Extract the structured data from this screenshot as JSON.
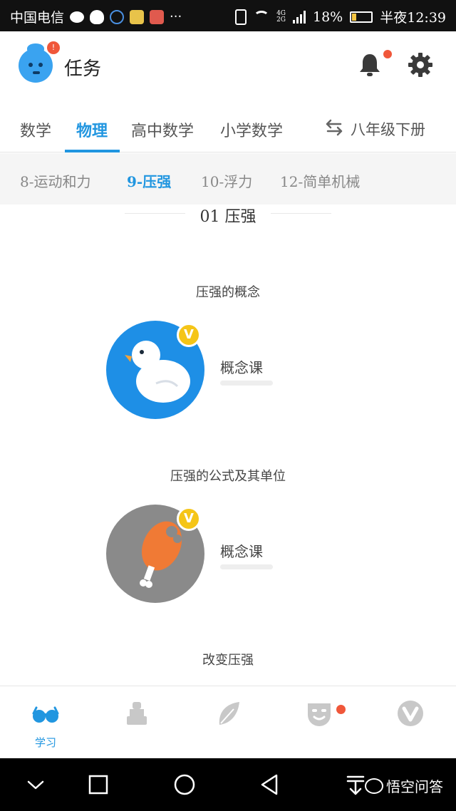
{
  "status_bar": {
    "carrier": "中国电信",
    "signal_labels": [
      "4G",
      "2G"
    ],
    "battery": "18%",
    "time": "半夜12:39",
    "more": "···"
  },
  "header": {
    "title": "任务",
    "avatar_badge": "!"
  },
  "subject_tabs": {
    "items": [
      "数学",
      "物理",
      "高中数学",
      "小学数学"
    ],
    "active": "物理",
    "grade": "八年级下册"
  },
  "chapter_tabs": {
    "items": [
      "8-运动和力",
      "9-压强",
      "10-浮力",
      "12-简单机械"
    ],
    "active": "9-压强"
  },
  "content": {
    "section_title": "01 压强",
    "topics": [
      {
        "title": "压强的概念",
        "lesson_label": "概念课",
        "badge": "V",
        "icon": "duck-icon",
        "circle_color": "#1e8fe6"
      },
      {
        "title": "压强的公式及其单位",
        "lesson_label": "概念课",
        "badge": "V",
        "icon": "drumstick-icon",
        "circle_color": "#8a8a8a"
      },
      {
        "title": "改变压强"
      }
    ]
  },
  "bottom_nav": {
    "items": [
      {
        "label": "学习",
        "icon": "glasses-icon"
      },
      {
        "label": "",
        "icon": "tower-icon"
      },
      {
        "label": "",
        "icon": "leaf-icon"
      },
      {
        "label": "",
        "icon": "mask-icon"
      },
      {
        "label": "",
        "icon": "vip-v-icon"
      }
    ]
  },
  "system_nav": {
    "watermark": "悟空问答"
  },
  "colors": {
    "accent": "#2196e0",
    "badge_red": "#f0573a",
    "vip_yellow": "#f5c518",
    "inactive_icon": "#c8c8c8"
  }
}
